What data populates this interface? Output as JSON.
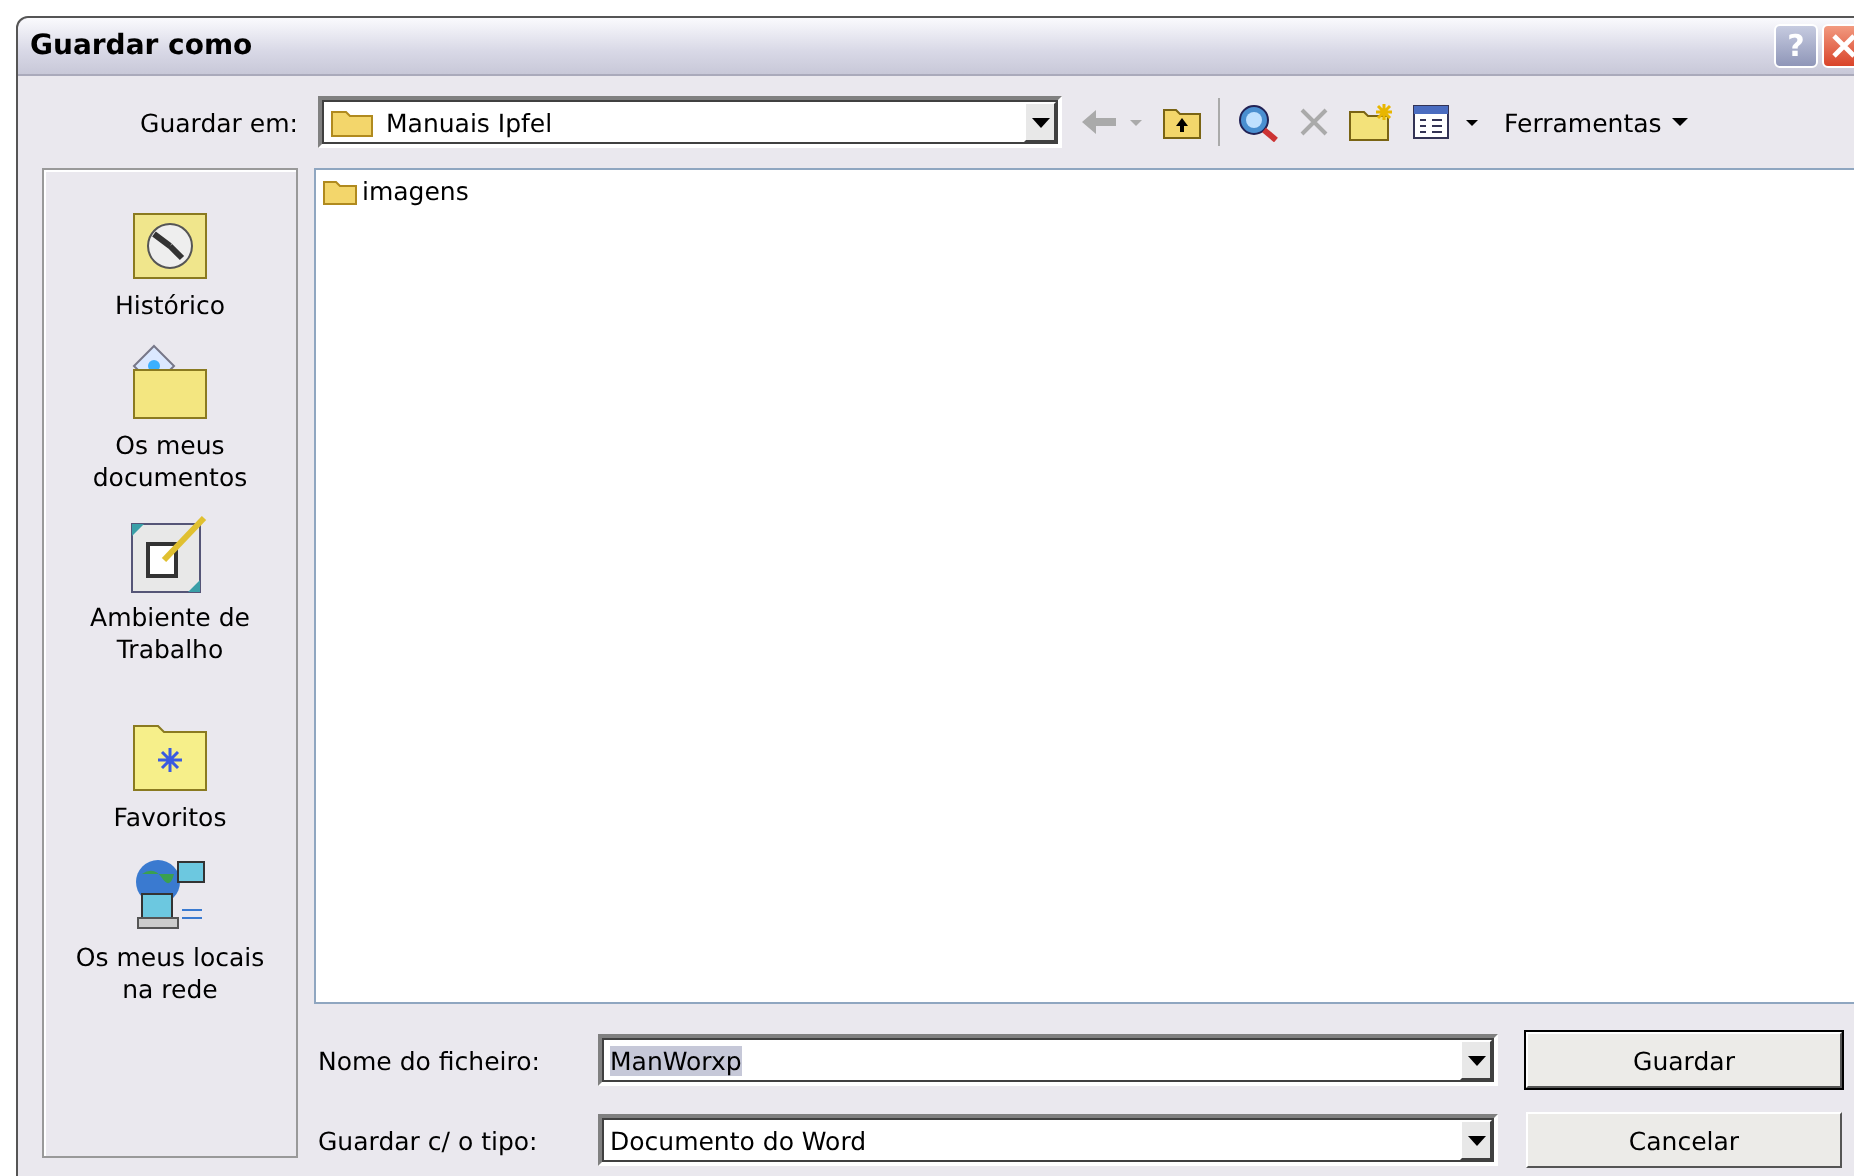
{
  "window": {
    "title": "Guardar como",
    "help_button": "?"
  },
  "toolbar": {
    "location_label": "Guardar em:",
    "location": "Manuais Ipfel",
    "tools_label": "Ferramentas"
  },
  "places": [
    {
      "kind": "history",
      "label": "Histórico"
    },
    {
      "kind": "documents",
      "label": "Os meus documentos"
    },
    {
      "kind": "desktop",
      "label": "Ambiente de Trabalho"
    },
    {
      "kind": "favorites",
      "label": "Favoritos"
    },
    {
      "kind": "network",
      "label": "Os meus locais na rede"
    }
  ],
  "files": [
    {
      "name": "imagens",
      "selected": false
    }
  ],
  "filename": {
    "label": "Nome do ficheiro:",
    "value": "ManWorxp",
    "text_selected": true
  },
  "filetype": {
    "label": "Guardar c/ o tipo:",
    "value": "Documento do Word"
  },
  "buttons": [
    {
      "label": "Guardar",
      "default": true
    },
    {
      "label": "Cancelar",
      "default": false
    }
  ]
}
